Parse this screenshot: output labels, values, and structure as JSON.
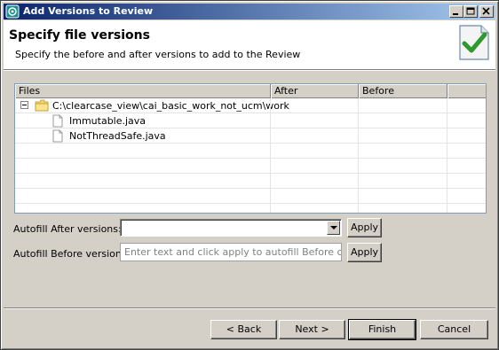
{
  "window": {
    "title": "Add Versions to Review"
  },
  "header": {
    "title": "Specify file versions",
    "description": "Specify the before and after versions to add to the Review",
    "icon": "checkmark-document-icon"
  },
  "table": {
    "columns": [
      "Files",
      "After",
      "Before",
      ""
    ],
    "rows": [
      {
        "type": "folder",
        "name": "C:\\clearcase_view\\cai_basic_work_not_ucm\\work",
        "after": "",
        "before": "",
        "expanded": true
      },
      {
        "type": "file",
        "name": "Immutable.java",
        "after": "",
        "before": ""
      },
      {
        "type": "file",
        "name": "NotThreadSafe.java",
        "after": "",
        "before": ""
      }
    ]
  },
  "autofill": {
    "after_label": "Autofill After versions:",
    "after_value": "",
    "before_label": "Autofill Before versions:",
    "before_value": "",
    "before_placeholder": "Enter text and click apply to autofill Before column",
    "apply_label": "Apply"
  },
  "buttons": {
    "back": "< Back",
    "next": "Next >",
    "finish": "Finish",
    "cancel": "Cancel"
  },
  "colors": {
    "title_bar_start": "#0a246a",
    "title_bar_end": "#a6caf0",
    "dialog_background": "#d4d0c8"
  }
}
